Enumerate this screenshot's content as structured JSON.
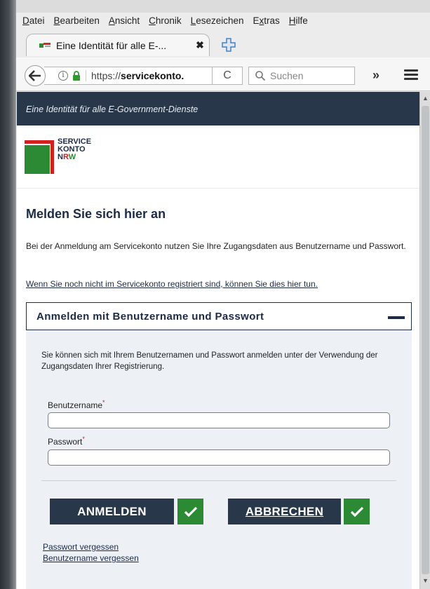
{
  "menu": {
    "items": [
      {
        "label": "Datei",
        "accel": "D",
        "rest": "atei"
      },
      {
        "label": "Bearbeiten",
        "accel": "B",
        "rest": "earbeiten"
      },
      {
        "label": "Ansicht",
        "accel": "A",
        "rest": "nsicht"
      },
      {
        "label": "Chronik",
        "accel": "C",
        "rest": "hronik"
      },
      {
        "label": "Lesezeichen",
        "accel": "L",
        "rest": "esezeichen"
      },
      {
        "label": "Extras",
        "pre": "E",
        "accel": "x",
        "rest": "tras"
      },
      {
        "label": "Hilfe",
        "accel": "H",
        "rest": "ilfe"
      }
    ]
  },
  "tab": {
    "title": "Eine Identität für alle E-...",
    "close_glyph": "✖"
  },
  "nav": {
    "url_prefix": "https://",
    "url_host": "servicekonto.",
    "reload_glyph": "C",
    "search_placeholder": "Suchen",
    "overflow_glyph": "»"
  },
  "site": {
    "header_tagline": "Eine Identität für alle E-Government-Dienste",
    "logo": {
      "line1": "SERVICE",
      "line2": "KONTO",
      "nrw_n": "N",
      "nrw_r": "R",
      "nrw_w": "W"
    }
  },
  "main": {
    "heading": "Melden Sie sich hier an",
    "intro": "Bei der Anmeldung am Servicekonto nutzen Sie Ihre Zugangsdaten aus Benutzername und Passwort.",
    "register_link": "Wenn Sie noch nicht im Servicekonto registriert sind, können Sie dies hier tun.",
    "accordion_title": "Anmelden mit Benutzername und Passwort",
    "panel_text": "Sie können sich mit Ihrem Benutzernamen und Passwort anmelden unter der Verwendung der Zugangsdaten Ihrer Registrierung.",
    "username_label": "Benutzername",
    "username_value": "",
    "password_label": "Passwort",
    "password_value": "",
    "required_marker": "*",
    "login_button": "ANMELDEN",
    "cancel_button": "ABBRECHEN",
    "forgot_password": "Passwort vergessen",
    "forgot_username": "Benutzername vergessen"
  },
  "colors": {
    "brand_navy": "#29374a",
    "brand_green": "#2c8a35",
    "brand_red": "#d1201e",
    "panel_bg": "#edf1f5"
  }
}
